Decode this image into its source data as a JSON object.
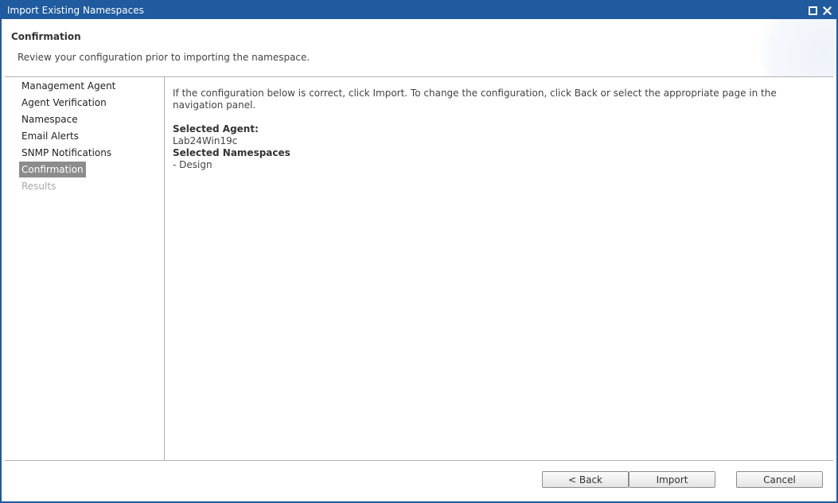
{
  "window": {
    "title": "Import Existing Namespaces",
    "maximize_icon": "maximize-icon",
    "close_icon": "close-icon"
  },
  "header": {
    "title": "Confirmation",
    "subtitle": "Review your configuration prior to importing the namespace."
  },
  "nav": {
    "items": [
      {
        "label": "Management Agent",
        "state": "normal"
      },
      {
        "label": "Agent Verification",
        "state": "normal"
      },
      {
        "label": "Namespace",
        "state": "normal"
      },
      {
        "label": "Email Alerts",
        "state": "normal"
      },
      {
        "label": "SNMP Notifications",
        "state": "normal"
      },
      {
        "label": "Confirmation",
        "state": "active"
      },
      {
        "label": "Results",
        "state": "disabled"
      }
    ]
  },
  "content": {
    "instructions": "If the configuration below is correct, click Import. To change the configuration, click Back or select the appropriate page in the navigation panel.",
    "agent_label": "Selected Agent:",
    "agent_value": "Lab24Win19c",
    "namespaces_label": "Selected Namespaces",
    "namespaces": [
      "- Design"
    ]
  },
  "buttons": {
    "back": "< Back",
    "import": "Import",
    "cancel": "Cancel"
  },
  "colors": {
    "titlebar": "#1f5b9e",
    "active_nav": "#8c8c8c",
    "disabled_nav": "#a8a8a8"
  }
}
